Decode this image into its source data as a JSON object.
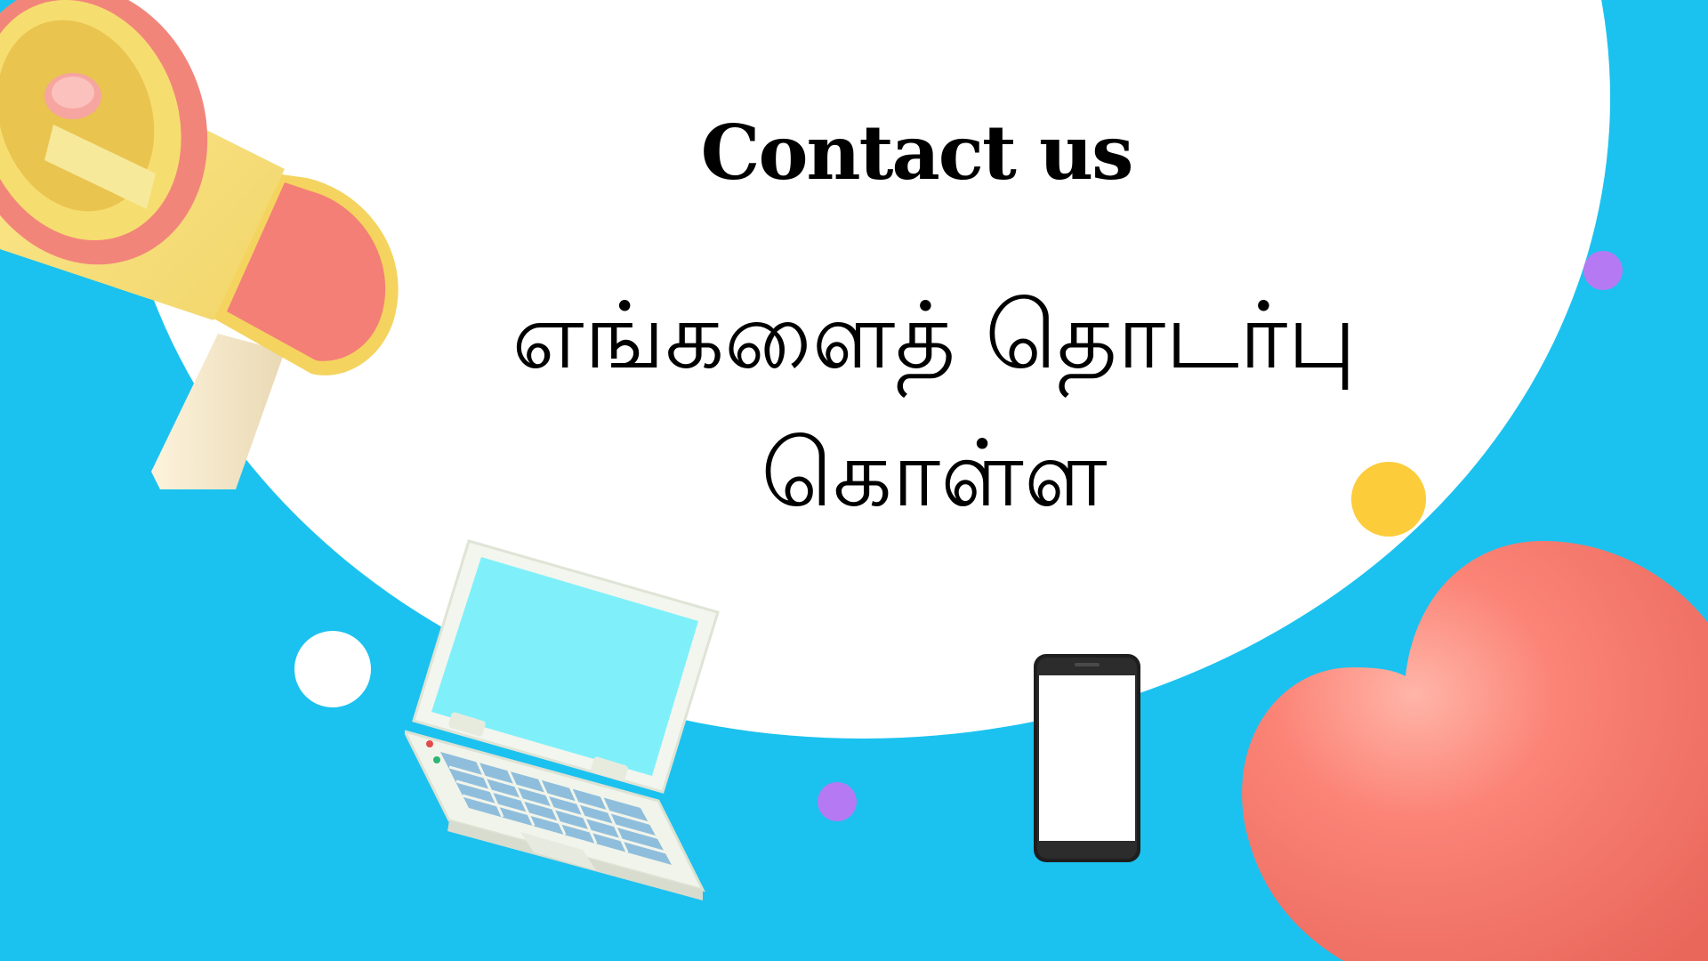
{
  "heading": {
    "english": "Contact us",
    "tamil": "எங்களைத் தொடர்பு கொள்ள"
  },
  "illustrations": {
    "megaphone": "megaphone-icon",
    "laptop": "laptop-icon",
    "phone": "smartphone-icon",
    "heart": "heart-icon"
  },
  "colors": {
    "background": "#1bc2ef",
    "panel": "#ffffff",
    "accent_purple": "#b57af3",
    "accent_yellow": "#fccc3b",
    "heart": "#f26f63",
    "text": "#000000"
  }
}
